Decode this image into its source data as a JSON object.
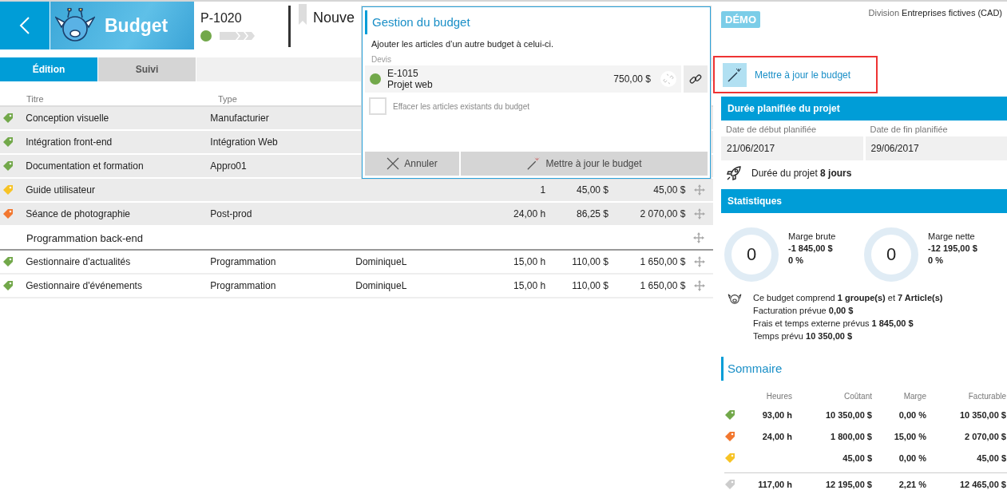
{
  "header": {
    "title": "Budget",
    "code": "P-1020",
    "active": true,
    "name": "Nouve"
  },
  "tabs": [
    {
      "label": "Édition",
      "selected": true
    },
    {
      "label": "Suivi",
      "selected": false
    }
  ],
  "table": {
    "columns": [
      "Titre",
      "Type"
    ],
    "rows": [
      {
        "kind": "item",
        "color": "#72a84a",
        "title": "Conception visuelle",
        "type": "Manufacturier"
      },
      {
        "kind": "item",
        "color": "#72a84a",
        "title": "Intégration front-end",
        "type": "Intégration Web"
      },
      {
        "kind": "item",
        "color": "#72a84a",
        "title": "Documentation et formation",
        "type": "Appro01"
      },
      {
        "kind": "item",
        "color": "#f7c325",
        "title": "Guide utilisateur",
        "type": "",
        "resource": "",
        "quantity": "1",
        "price": "45,00 $",
        "total": "45,00 $"
      },
      {
        "kind": "item",
        "color": "#f2772f",
        "title": "Séance de photographie",
        "type": "Post-prod",
        "resource": "",
        "quantity": "24,00 h",
        "price": "86,25 $",
        "total": "2 070,00 $"
      },
      {
        "kind": "group",
        "title": "Programmation back-end",
        "children": [
          {
            "kind": "item",
            "color": "#72a84a",
            "title": "Gestionnaire d'actualités",
            "type": "Programmation",
            "resource": "DominiqueL",
            "quantity": "15,00 h",
            "price": "110,00 $",
            "total": "1 650,00 $"
          },
          {
            "kind": "item",
            "color": "#72a84a",
            "title": "Gestionnaire d'événements",
            "type": "Programmation",
            "resource": "DominiqueL",
            "quantity": "15,00 h",
            "price": "110,00 $",
            "total": "1 650,00 $"
          }
        ]
      }
    ]
  },
  "dialog": {
    "title": "Gestion du budget",
    "description": "Ajouter les articles d’un autre budget à celui-ci.",
    "section": "Devis",
    "quote": {
      "active": true,
      "code": "E-1015",
      "name": "Projet web",
      "amount": "750,00 $"
    },
    "clear_option": {
      "label": "Effacer les articles existants du budget",
      "checked": false
    },
    "buttons": [
      {
        "kind": "cancel",
        "label": "Annuler"
      },
      {
        "kind": "update",
        "label": "Mettre à jour le budget"
      }
    ]
  },
  "side": {
    "badge": "DÉMO",
    "division_label": "Division",
    "division": "Entreprises fictives (CAD)",
    "update_action": "Mettre à jour le budget",
    "duration": {
      "title": "Durée planifiée du projet",
      "start_label": "Date de début planifiée",
      "end_label": "Date de fin planifiée",
      "start": "21/06/2017",
      "end": "29/06/2017",
      "summary": "Durée du projet **8 jours**"
    },
    "stats": {
      "title": "Statistiques",
      "gauges": [
        {
          "value": "0",
          "label": "Marge brute",
          "amount": "-1 845,00 $",
          "percent": "0 %"
        },
        {
          "value": "0",
          "label": "Marge nette",
          "amount": "-12 195,00 $",
          "percent": "0 %"
        }
      ],
      "lines": [
        "Ce budget comprend **1 groupe(s)** et **7 Article(s)**",
        "Facturation prévue **0,00 $**",
        "Frais et temps externe prévus **1 845,00 $**",
        "Temps prévu **10 350,00 $**"
      ]
    },
    "summary": {
      "title": "Sommaire",
      "columns": [
        "Heures",
        "Coûtant",
        "Marge",
        "Facturable"
      ],
      "rows": [
        {
          "color": "#72a84a",
          "cells": [
            "93,00 h",
            "10 350,00 $",
            "0,00 %",
            "10 350,00 $"
          ]
        },
        {
          "color": "#f2772f",
          "cells": [
            "24,00 h",
            "1 800,00 $",
            "15,00 %",
            "2 070,00 $"
          ]
        },
        {
          "color": "#f7c325",
          "cells": [
            "",
            "45,00 $",
            "0,00 %",
            "45,00 $"
          ]
        }
      ],
      "total": {
        "color": "#cccccc",
        "cells": [
          "117,00 h",
          "12 195,00 $",
          "2,21 %",
          "12 465,00 $"
        ]
      }
    }
  }
}
